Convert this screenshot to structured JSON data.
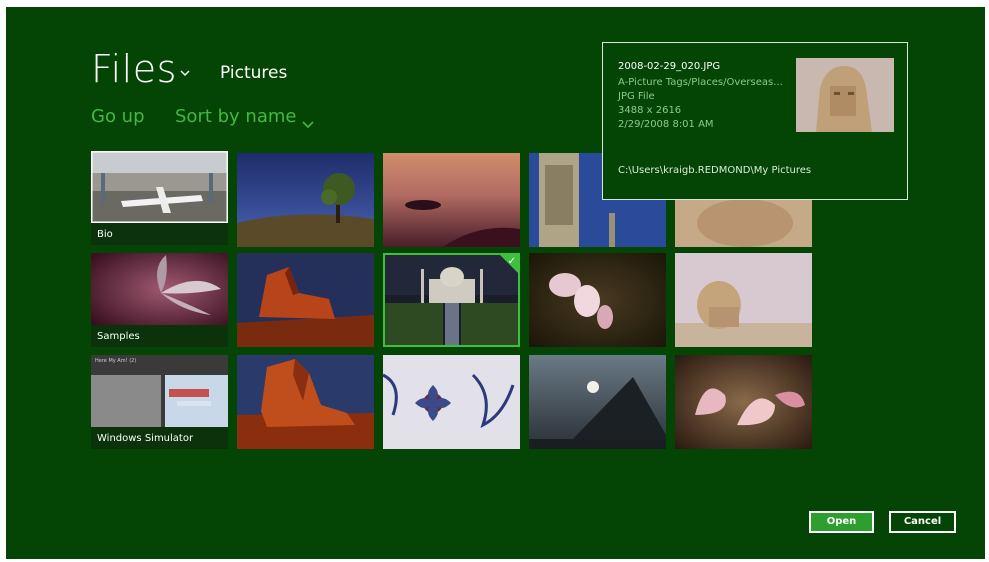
{
  "header": {
    "title": "Files",
    "location": "Pictures"
  },
  "commands": {
    "go_up": "Go up",
    "sort": "Sort by name"
  },
  "folders": [
    {
      "label": "Bio"
    },
    {
      "label": "Samples"
    },
    {
      "label": "Windows Simulator",
      "preview_text": "Here My Am! (2)"
    }
  ],
  "info_panel": {
    "filename": "2008-02-29_020.JPG",
    "tags": "A-Picture Tags/Places/Overseas...",
    "type": "JPG File",
    "dimensions": "3488 x 2616",
    "date": "2/29/2008 8:01 AM",
    "path": "C:\\Users\\kraigb.REDMOND\\My Pictures"
  },
  "buttons": {
    "open": "Open",
    "cancel": "Cancel"
  },
  "colors": {
    "background": "#044404",
    "accent": "#43b843",
    "selection": "#3fbf3f"
  },
  "icons": {
    "title_chevron": "chevron-down-icon",
    "sort_chevron": "chevron-down-icon",
    "selected_check": "checkmark-icon"
  }
}
